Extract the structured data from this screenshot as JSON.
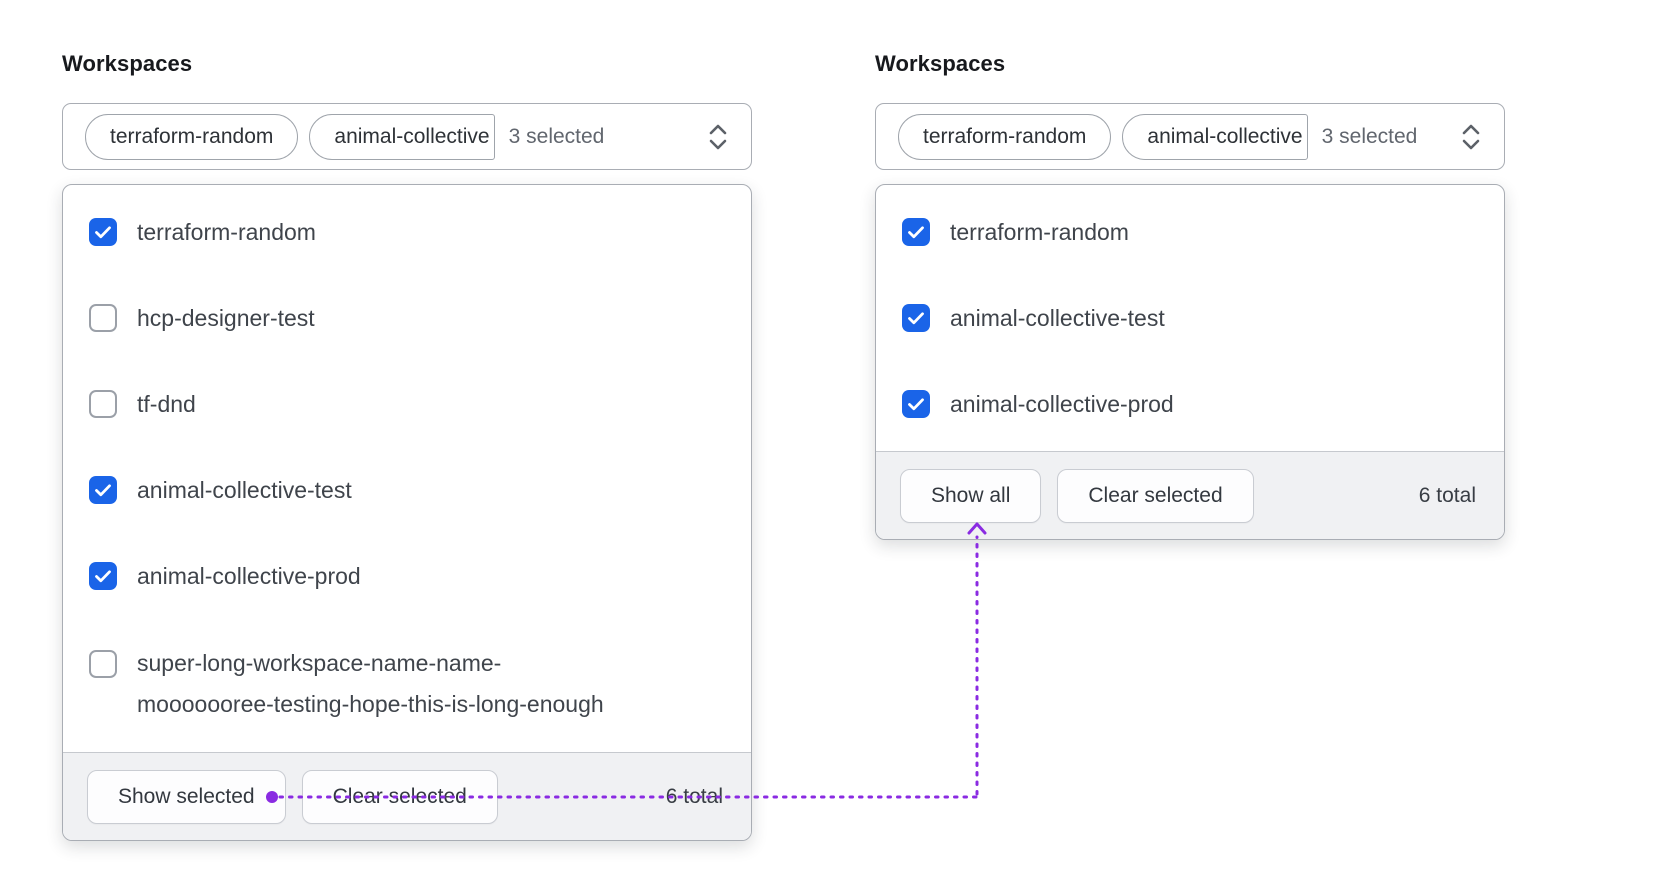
{
  "colors": {
    "checkbox_blue": "#1a64e8",
    "connector_purple": "#8a2be2",
    "footer_bg": "#f0f1f3",
    "border_gray": "#a9adb4"
  },
  "left_panel": {
    "label": "Workspaces",
    "combobox": {
      "tags": [
        "terraform-random",
        "animal-collective"
      ],
      "summary": "3 selected"
    },
    "options": [
      {
        "label_lines": [
          "terraform-random"
        ],
        "checked": true
      },
      {
        "label_lines": [
          "hcp-designer-test"
        ],
        "checked": false
      },
      {
        "label_lines": [
          "tf-dnd"
        ],
        "checked": false
      },
      {
        "label_lines": [
          "animal-collective-test"
        ],
        "checked": true
      },
      {
        "label_lines": [
          "animal-collective-prod"
        ],
        "checked": true
      },
      {
        "label_lines": [
          "super-long-workspace-name-name-",
          "mooooooree-testing-hope-this-is-long-enough"
        ],
        "checked": false
      }
    ],
    "footer": {
      "show_label": "Show selected",
      "clear_label": "Clear selected",
      "total": "6 total"
    }
  },
  "right_panel": {
    "label": "Workspaces",
    "combobox": {
      "tags": [
        "terraform-random",
        "animal-collective"
      ],
      "summary": "3 selected"
    },
    "options": [
      {
        "label_lines": [
          "terraform-random"
        ],
        "checked": true
      },
      {
        "label_lines": [
          "animal-collective-test"
        ],
        "checked": true
      },
      {
        "label_lines": [
          "animal-collective-prod"
        ],
        "checked": true
      }
    ],
    "footer": {
      "show_label": "Show all",
      "clear_label": "Clear selected",
      "total": "6 total"
    }
  },
  "connector": {
    "from": "show-selected-button",
    "to": "show-all-button",
    "color": "#8a2be2"
  }
}
